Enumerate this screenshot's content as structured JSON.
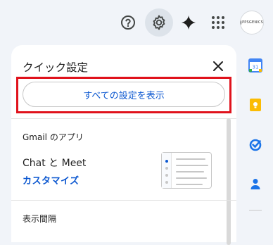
{
  "topbar": {
    "help_icon": "help-circle-icon",
    "settings_icon": "gear-icon",
    "gemini_icon": "gemini-sparkle-icon",
    "apps_icon": "apps-grid-icon",
    "avatar_text": "PPSGENICS"
  },
  "quick_settings": {
    "title": "クイック設定",
    "close_icon": "close-icon",
    "show_all_label": "すべての設定を表示",
    "apps_section_label": "Gmail のアプリ",
    "chat_meet_label": "Chat と Meet",
    "customize_label": "カスタマイズ",
    "density_label": "表示間隔"
  },
  "side_panel": {
    "items": [
      "calendar-icon",
      "keep-icon",
      "tasks-icon",
      "contacts-icon"
    ],
    "calendar_day": "31"
  },
  "colors": {
    "accent": "#0b57d0",
    "highlight": "#e0121c"
  }
}
